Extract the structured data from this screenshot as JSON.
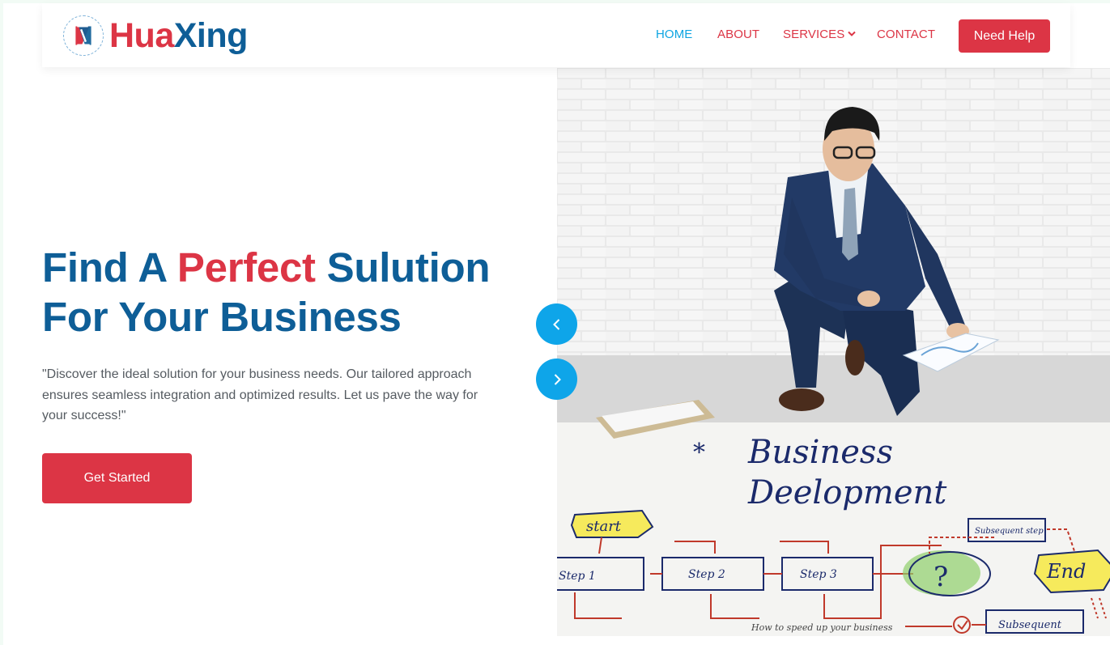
{
  "brand": {
    "name_part1": "Hua",
    "name_part2": "Xing",
    "logo_icon": "hx-logo-icon",
    "colors": {
      "red": "#dc3545",
      "blue": "#0e5e97"
    }
  },
  "nav": {
    "items": [
      {
        "label": "HOME",
        "active": true
      },
      {
        "label": "ABOUT",
        "active": false
      },
      {
        "label": "SERVICES",
        "active": false,
        "has_dropdown": true
      },
      {
        "label": "CONTACT",
        "active": false
      }
    ],
    "cta_label": "Need Help",
    "active_color": "#0ea5e2"
  },
  "hero": {
    "title_part1": "Find A ",
    "title_accent": "Perfect",
    "title_part2": " Sulution",
    "title_line2": "For Your Business",
    "description": "\"Discover the ideal solution for your business needs. Our tailored approach ensures seamless integration and optimized results. Let us pave the way for your success!\"",
    "cta_label": "Get Started"
  },
  "carousel": {
    "prev_icon": "chevron-left-icon",
    "next_icon": "chevron-right-icon",
    "button_color": "#0ea5e9"
  },
  "illustration": {
    "heading_line1": "Business",
    "heading_line2": "Deelopment",
    "star_mark": "*",
    "labels": {
      "start": "start",
      "step1": "Step 1",
      "step2": "Step 2",
      "step3": "Step 3",
      "question": "?",
      "end": "End",
      "subsequent_top": "Subsequent step",
      "subsequent_bottom": "Subsequent",
      "footer_note": "How to speed up your business"
    }
  }
}
